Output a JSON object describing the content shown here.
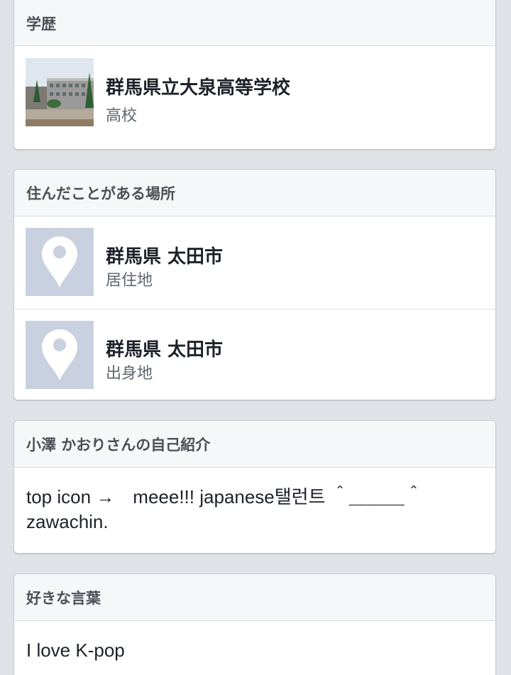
{
  "education": {
    "header": "学歴",
    "items": [
      {
        "name": "群馬県立大泉高等学校",
        "type": "高校",
        "icon": "school-photo"
      }
    ]
  },
  "places": {
    "header": "住んだことがある場所",
    "items": [
      {
        "name": "群馬県 太田市",
        "type": "居住地",
        "icon": "location-pin-icon"
      },
      {
        "name": "群馬県 太田市",
        "type": "出身地",
        "icon": "location-pin-icon"
      }
    ]
  },
  "about": {
    "header": "小澤 かおりさんの自己紹介",
    "text": "top icon →　meee!!! japanese탤런트 ＾＿＿＿＾\nzawachin."
  },
  "quotes": {
    "header": "好きな言葉",
    "text": "I love K-pop"
  },
  "colors": {
    "background": "#dfe2e6",
    "card_header": "#f5f7f9",
    "pin_box": "#c9d0df"
  }
}
